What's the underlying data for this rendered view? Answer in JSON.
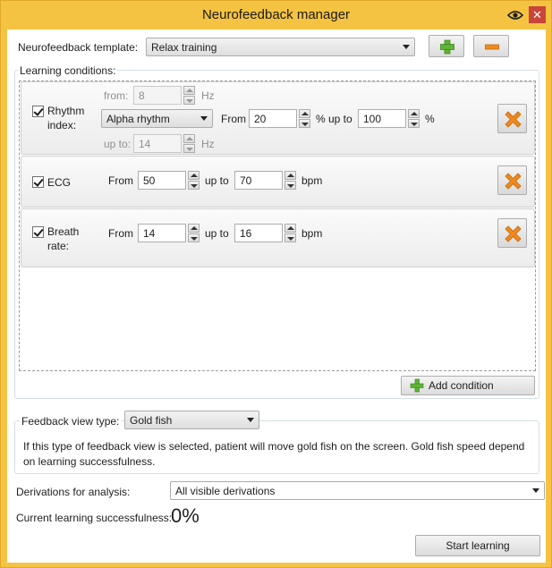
{
  "window": {
    "title": "Neurofeedback manager",
    "close_glyph": "✕"
  },
  "template": {
    "label": "Neurofeedback template:",
    "value": "Relax training"
  },
  "conditions": {
    "group_label": "Learning conditions:",
    "rhythm": {
      "label_line1": "Rhythm",
      "label_line2": "index:",
      "checked": true,
      "rhythm_value": "Alpha rhythm",
      "from_label": "from:",
      "from_hz": "8",
      "upto_label": "up to:",
      "upto_hz": "14",
      "hz_unit": "Hz",
      "range_from_label": "From",
      "range_from": "20",
      "range_mid_label": "% up to",
      "range_to": "100",
      "range_unit": "%"
    },
    "ecg": {
      "label": "ECG",
      "checked": true,
      "from_label": "From",
      "from": "50",
      "upto_label": "up to",
      "to": "70",
      "unit": "bpm"
    },
    "breath": {
      "label_line1": "Breath",
      "label_line2": "rate:",
      "checked": true,
      "from_label": "From",
      "from": "14",
      "upto_label": "up to",
      "to": "16",
      "unit": "bpm"
    },
    "add_condition_label": "Add condition"
  },
  "feedback": {
    "label": "Feedback view type:",
    "value": "Gold fish",
    "description": "If this type of feedback view is selected, patient will move gold fish on the screen. Gold fish speed depend on learning successfulness."
  },
  "derivations": {
    "label": "Derivations for analysis:",
    "value": "All visible derivations"
  },
  "success": {
    "label": "Current learning successfulness:",
    "value": "0%"
  },
  "start_button_label": "Start learning",
  "colors": {
    "titlebar": "#f5c342",
    "accent_green": "#5fb336",
    "accent_orange": "#f08a1e",
    "close_red": "#c9453a"
  }
}
